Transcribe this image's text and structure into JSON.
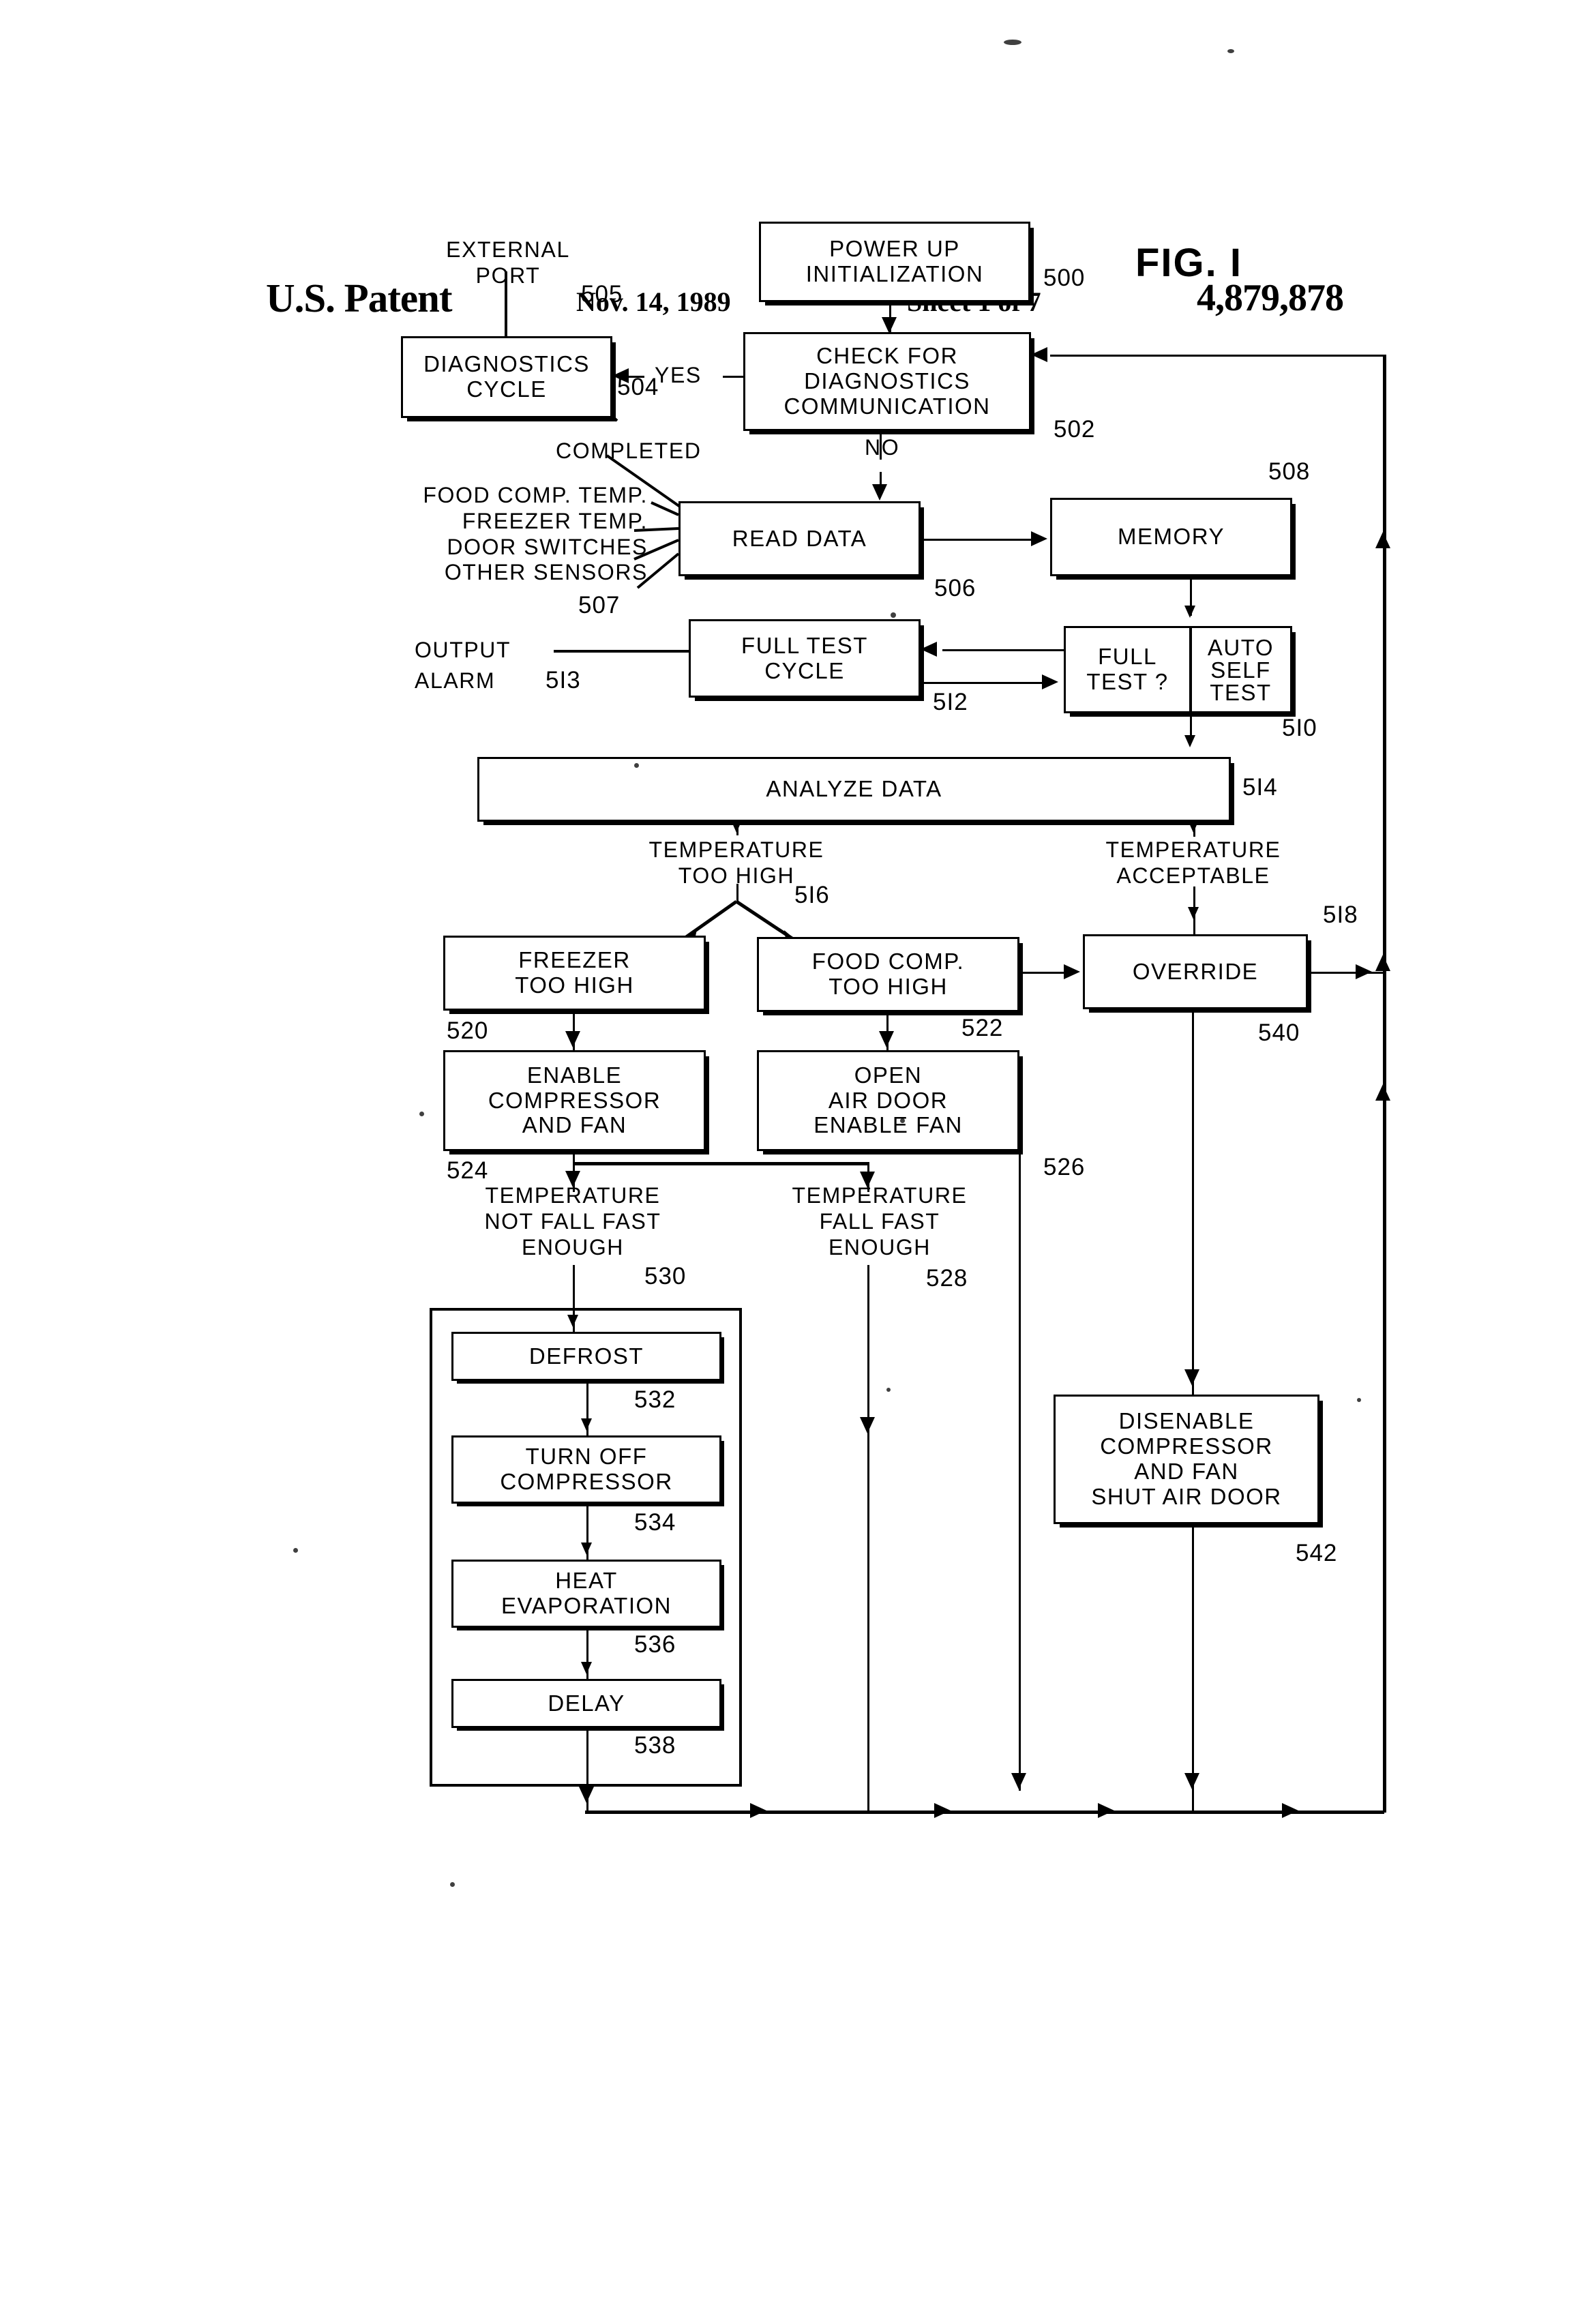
{
  "header": {
    "office": "U.S. Patent",
    "date": "Nov. 14, 1989",
    "sheet": "Sheet 1 of 7",
    "patent_number": "4,879,878"
  },
  "figure": {
    "label": "FIG. I"
  },
  "boxes": {
    "power_up": "POWER UP\nINITIALIZATION",
    "power_up_l1": "POWER UP",
    "power_up_l2": "INITIALIZATION",
    "check_l1": "CHECK  FOR",
    "check_l2": "DIAGNOSTICS",
    "check_l3": "COMMUNICATION",
    "diagnostics_l1": "DIAGNOSTICS",
    "diagnostics_l2": "CYCLE",
    "read_data": "READ DATA",
    "memory": "MEMORY",
    "full_test_cycle_l1": "FULL TEST",
    "full_test_cycle_l2": "CYCLE",
    "full_test_q_l1": "FULL",
    "full_test_q_l2": "TEST ?",
    "auto_self_test_l1": "AUTO",
    "auto_self_test_l2": "SELF",
    "auto_self_test_l3": "TEST",
    "analyze_data": "ANALYZE DATA",
    "freezer_too_high_l1": "FREEZER",
    "freezer_too_high_l2": "TOO HIGH",
    "food_comp_too_high_l1": "FOOD COMP.",
    "food_comp_too_high_l2": "TOO HIGH",
    "override": "OVERRIDE",
    "enable_comp_l1": "ENABLE",
    "enable_comp_l2": "COMPRESSOR",
    "enable_comp_l3": "AND FAN",
    "open_air_door_l1": "OPEN",
    "open_air_door_l2": "AIR  DOOR",
    "open_air_door_l3": "ENABLE  FAN",
    "defrost": "DEFROST",
    "turn_off_comp_l1": "TURN  OFF",
    "turn_off_comp_l2": "COMPRESSOR",
    "heat_evap_l1": "HEAT",
    "heat_evap_l2": "EVAPORATION",
    "delay": "DELAY",
    "disenable_l1": "DISENABLE",
    "disenable_l2": "COMPRESSOR",
    "disenable_l3": "AND FAN",
    "disenable_l4": "SHUT AIR DOOR"
  },
  "labels": {
    "external_port_l1": "EXTERNAL",
    "external_port_l2": "PORT",
    "yes": "YES",
    "no": "NO",
    "completed": "COMPLETED",
    "sensors_l1": "FOOD COMP. TEMP.",
    "sensors_l2": "FREEZER TEMP.",
    "sensors_l3": "DOOR SWITCHES",
    "sensors_l4": "OTHER SENSORS",
    "output": "OUTPUT",
    "alarm": "ALARM",
    "temp_too_high_l1": "TEMPERATURE",
    "temp_too_high_l2": "TOO HIGH",
    "temp_acceptable_l1": "TEMPERATURE",
    "temp_acceptable_l2": "ACCEPTABLE",
    "temp_not_fall_l1": "TEMPERATURE",
    "temp_not_fall_l2": "NOT FALL FAST",
    "temp_not_fall_l3": "ENOUGH",
    "temp_fall_l1": "TEMPERATURE",
    "temp_fall_l2": "FALL FAST",
    "temp_fall_l3": "ENOUGH"
  },
  "refs": {
    "r500": "500",
    "r502": "502",
    "r504": "504",
    "r505": "505",
    "r506": "506",
    "r507": "507",
    "r508": "508",
    "r510": "5I0",
    "r512": "5I2",
    "r513": "5I3",
    "r514": "5I4",
    "r516": "5I6",
    "r518": "5I8",
    "r520": "520",
    "r522": "522",
    "r524": "524",
    "r526": "526",
    "r528": "528",
    "r530": "530",
    "r532": "532",
    "r534": "534",
    "r536": "536",
    "r538": "538",
    "r540": "540",
    "r542": "542"
  },
  "colors": {
    "ink": "#000000",
    "paper": "#ffffff"
  }
}
